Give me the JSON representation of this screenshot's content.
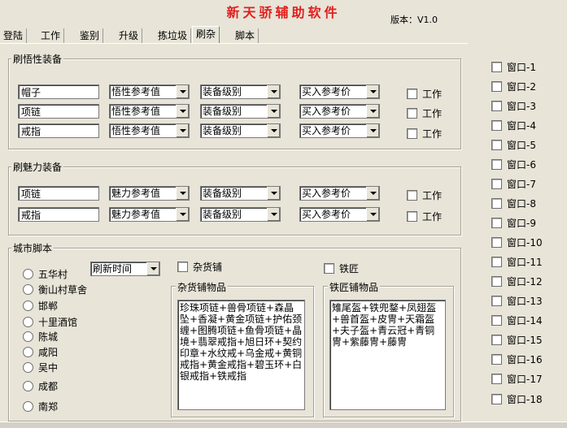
{
  "app": {
    "title": "新天骄辅助软件",
    "version": "版本：V1.0"
  },
  "tabs": [
    {
      "label": "登陆"
    },
    {
      "label": "工作"
    },
    {
      "label": "鉴别"
    },
    {
      "label": "升级"
    },
    {
      "label": "拣垃圾"
    },
    {
      "label": "刷杂"
    },
    {
      "label": "脚本"
    }
  ],
  "active_tab": "刷杂",
  "wuxing": {
    "legend": "刷悟性装备",
    "rows": [
      {
        "item": "帽子",
        "attr": "悟性参考值",
        "level": "装备级别",
        "price": "买入参考价",
        "work": "工作"
      },
      {
        "item": "项链",
        "attr": "悟性参考值",
        "level": "装备级别",
        "price": "买入参考价",
        "work": "工作"
      },
      {
        "item": "戒指",
        "attr": "悟性参考值",
        "level": "装备级别",
        "price": "买入参考价",
        "work": "工作"
      }
    ]
  },
  "meili": {
    "legend": "刷魅力装备",
    "rows": [
      {
        "item": "项链",
        "attr": "魅力参考值",
        "level": "装备级别",
        "price": "买入参考价",
        "work": "工作"
      },
      {
        "item": "戒指",
        "attr": "魅力参考值",
        "level": "装备级别",
        "price": "买入参考价",
        "work": "工作"
      }
    ]
  },
  "city": {
    "legend": "城市脚本",
    "cities": [
      "五华村",
      "衡山村草舍",
      "邯郸",
      "十里酒馆",
      "陈城",
      "咸阳",
      "吴中",
      "成都",
      "南郑"
    ],
    "refresh": "刷新时间",
    "grocery_check": "杂货铺",
    "smith_check": "铁匠",
    "grocery_label": "杂货铺物品",
    "grocery_items": "珍珠项链+兽骨项链+森晶坠+香凝+黄金项链+护佑颈缠+图腾项链+鱼骨项链+晶境+翡翠戒指+旭日环+契约印章+水纹戒+乌金戒+黄铜戒指+黄金戒指+碧玉环+白银戒指+铁戒指",
    "smith_label": "铁匠铺物品",
    "smith_items": "雉尾盔+铁兜鍪+凤翅盔+兽首盔+皮冑+天霜盔+夫子盔+青云冠+青铜冑+紫藤冑+藤冑"
  },
  "windows": [
    "窗口-1",
    "窗口-2",
    "窗口-3",
    "窗口-4",
    "窗口-5",
    "窗口-6",
    "窗口-7",
    "窗口-8",
    "窗口-9",
    "窗口-10",
    "窗口-11",
    "窗口-12",
    "窗口-13",
    "窗口-14",
    "窗口-15",
    "窗口-16",
    "窗口-17",
    "窗口-18"
  ]
}
